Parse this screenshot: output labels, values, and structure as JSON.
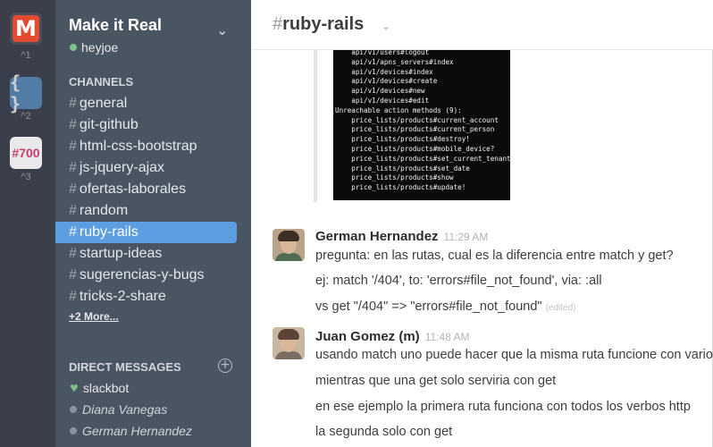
{
  "teams": [
    {
      "label": "M",
      "shortcut": "^1"
    },
    {
      "label": "{ }",
      "shortcut": "^2"
    },
    {
      "label": "#700",
      "shortcut": "^3"
    }
  ],
  "sidebar": {
    "team_name": "Make it Real",
    "username": "heyjoe",
    "channels_title": "CHANNELS",
    "channels": [
      "general",
      "git-github",
      "html-css-bootstrap",
      "js-jquery-ajax",
      "ofertas-laborales",
      "random",
      "ruby-rails",
      "startup-ideas",
      "sugerencias-y-bugs",
      "tricks-2-share"
    ],
    "active_channel": "ruby-rails",
    "more_label": "+2 More...",
    "dm_title": "DIRECT MESSAGES",
    "dms": [
      {
        "name": "slackbot"
      },
      {
        "name": "Diana Vanegas"
      },
      {
        "name": "German Hernandez"
      }
    ]
  },
  "main": {
    "channel_hash": "#",
    "channel_name": "ruby-rails",
    "code_lines": [
      "    api/v1/users#logout",
      "    api/v1/apns_servers#index",
      "    api/v1/devices#index",
      "    api/v1/devices#create",
      "    api/v1/devices#new",
      "    api/v1/devices#edit",
      "Unreachable action methods (9):",
      "    price_lists/products#current_account",
      "    price_lists/products#current_person",
      "    price_lists/products#destroy!",
      "    price_lists/products#mobile_device?",
      "    price_lists/products#set_current_tenant",
      "    price_lists/products#set_date",
      "    price_lists/products#show",
      "    price_lists/products#update!"
    ],
    "messages": [
      {
        "author": "German Hernandez",
        "time": "11:29 AM",
        "lines": [
          "pregunta: en las rutas, cual es la diferencia entre match y get?",
          "ej: match '/404', to: 'errors#file_not_found', via: :all",
          "vs  get \"/404\" => \"errors#file_not_found\""
        ],
        "edited_label": "(edited)"
      },
      {
        "author": "Juan Gomez (m)",
        "time": "11:48 AM",
        "lines": [
          "usando match uno puede hacer que la misma ruta funcione con vario",
          "mientras que una get solo serviria con get",
          "en ese ejemplo la primera ruta funciona con todos los verbos http",
          "la segunda solo con get"
        ]
      }
    ]
  },
  "colors": {
    "rail_bg": "#3b3f4c",
    "sidebar_bg": "#4a5562",
    "active_channel_bg": "#5d9ee0",
    "presence_active": "#7fc18b"
  }
}
